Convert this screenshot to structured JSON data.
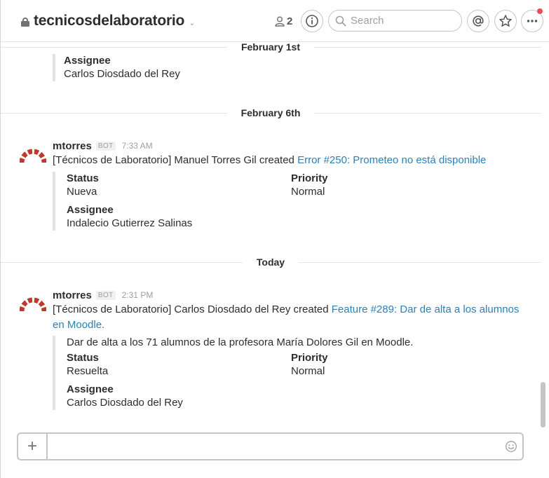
{
  "header": {
    "channel_name": "tecnicosdelaboratorio",
    "member_count": "2",
    "search_placeholder": "Search",
    "icons": [
      "lock-icon",
      "chevron-down-icon",
      "person-icon",
      "info-icon",
      "search-icon",
      "mention-icon",
      "star-icon",
      "more-icon"
    ],
    "notification_color": "#eb4d5c"
  },
  "dividers": {
    "first": "February 1st",
    "second": "February 6th",
    "third": "Today"
  },
  "top_partial": {
    "assignee_title": "Assignee",
    "assignee_value": "Carlos Diosdado del Rey"
  },
  "message1": {
    "author": "mtorres",
    "badge": "BOT",
    "time": "7:33 AM",
    "text_prefix": "[Técnicos de Laboratorio] Manuel Torres Gil created ",
    "link_text": "Error #250: Prometeo no está disponible",
    "status_title": "Status",
    "status_value": "Nueva",
    "priority_title": "Priority",
    "priority_value": "Normal",
    "assignee_title": "Assignee",
    "assignee_value": "Indalecio Gutierrez Salinas"
  },
  "message2": {
    "author": "mtorres",
    "badge": "BOT",
    "time": "2:31 PM",
    "text_prefix": "[Técnicos de Laboratorio] Carlos Diosdado del Rey created ",
    "link_text": "Feature #289: Dar de alta a los alumnos en Moodle.",
    "description": "Dar de alta a los 71 alumnos de la profesora María Dolores Gil en Moodle.",
    "status_title": "Status",
    "status_value": "Resuelta",
    "priority_title": "Priority",
    "priority_value": "Normal",
    "assignee_title": "Assignee",
    "assignee_value": "Carlos Diosdado del Rey"
  },
  "composer": {
    "placeholder": ""
  },
  "colors": {
    "link": "#2a80b9",
    "avatar_red": "#c0392b"
  }
}
